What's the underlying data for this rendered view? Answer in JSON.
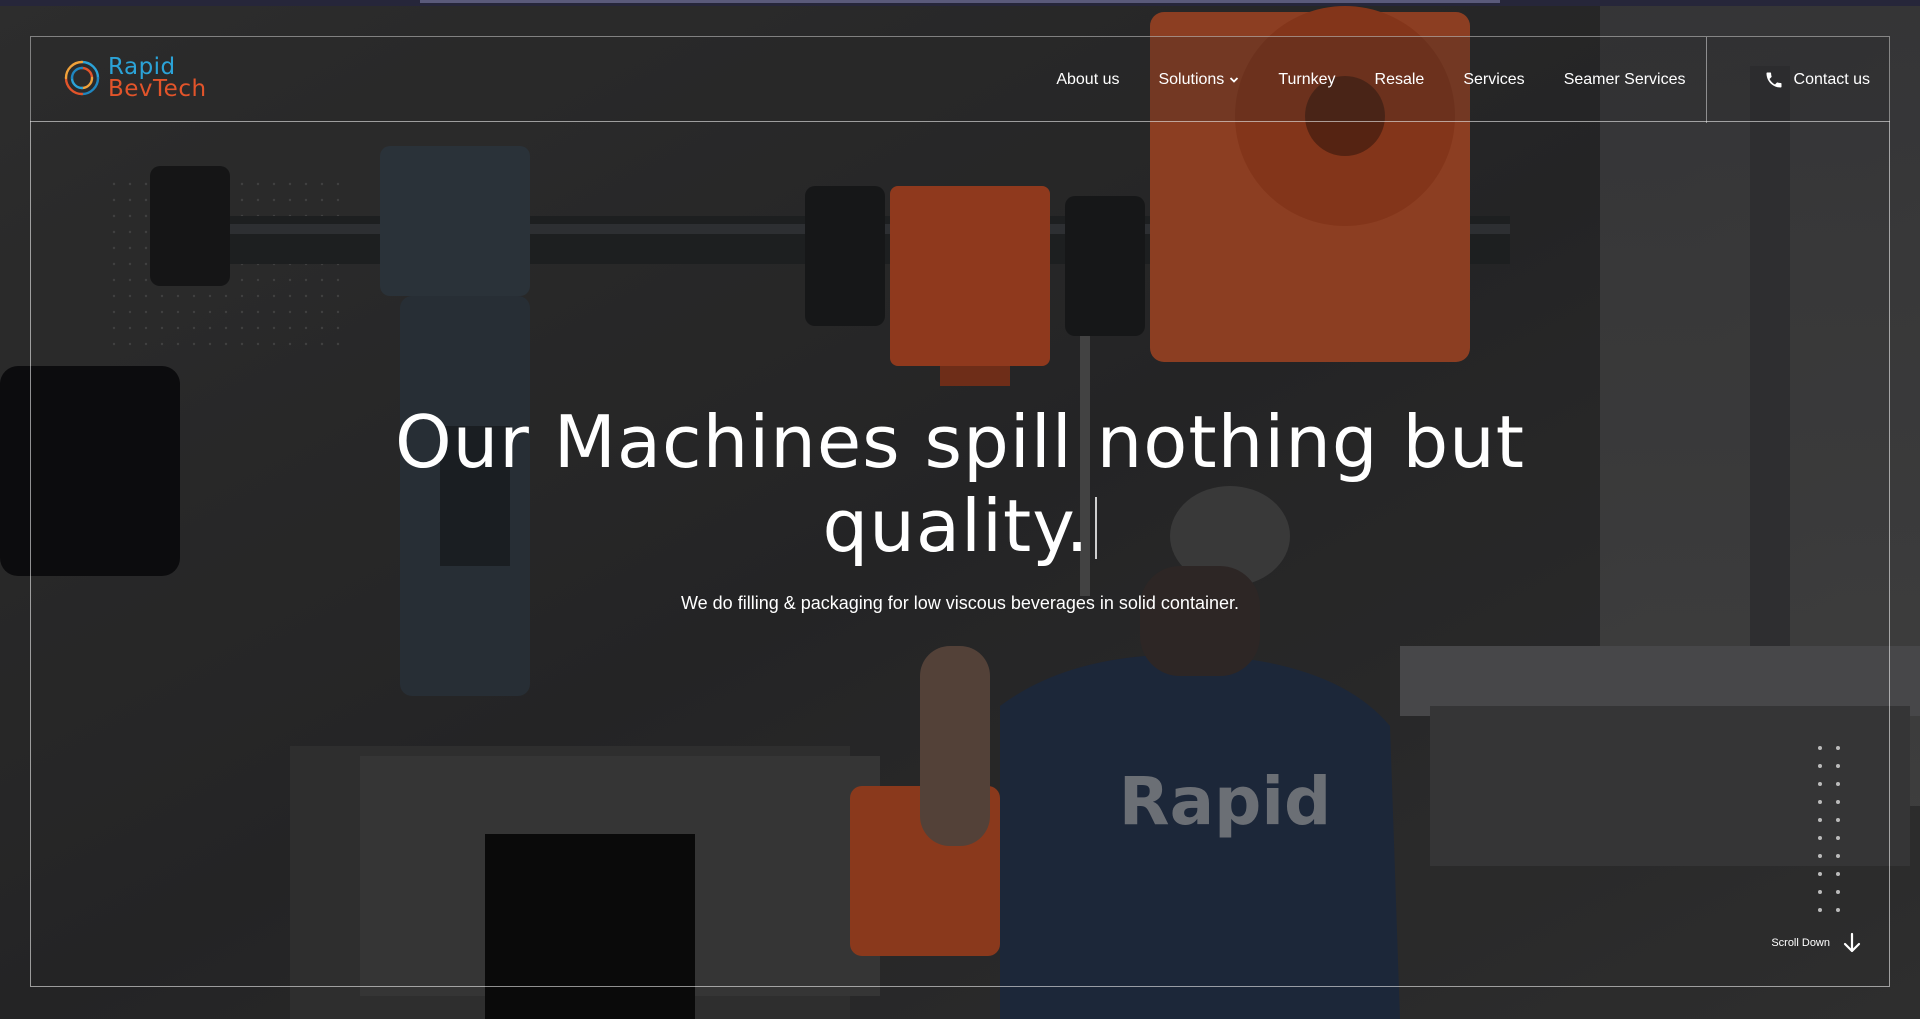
{
  "brand": {
    "name_line1": "Rapid",
    "name_line2": "BevTech",
    "color_primary": "#2ba3d8",
    "color_secondary": "#e2542a"
  },
  "nav": {
    "items": [
      {
        "label": "About us"
      },
      {
        "label": "Solutions",
        "icon": "chevron-down-icon"
      },
      {
        "label": "Turnkey"
      },
      {
        "label": "Resale"
      },
      {
        "label": "Services"
      },
      {
        "label": "Seamer Services"
      }
    ],
    "contact": {
      "label": "Contact us",
      "icon": "phone-icon"
    }
  },
  "hero": {
    "title_line1": "Our Machines spill nothing but",
    "title_line2": "quality.",
    "subtitle": "We do filling & packaging for low viscous beverages in solid container.",
    "shirt_print": "Rapid"
  },
  "scroll": {
    "label": "Scroll Down",
    "icon": "arrow-down-icon"
  }
}
